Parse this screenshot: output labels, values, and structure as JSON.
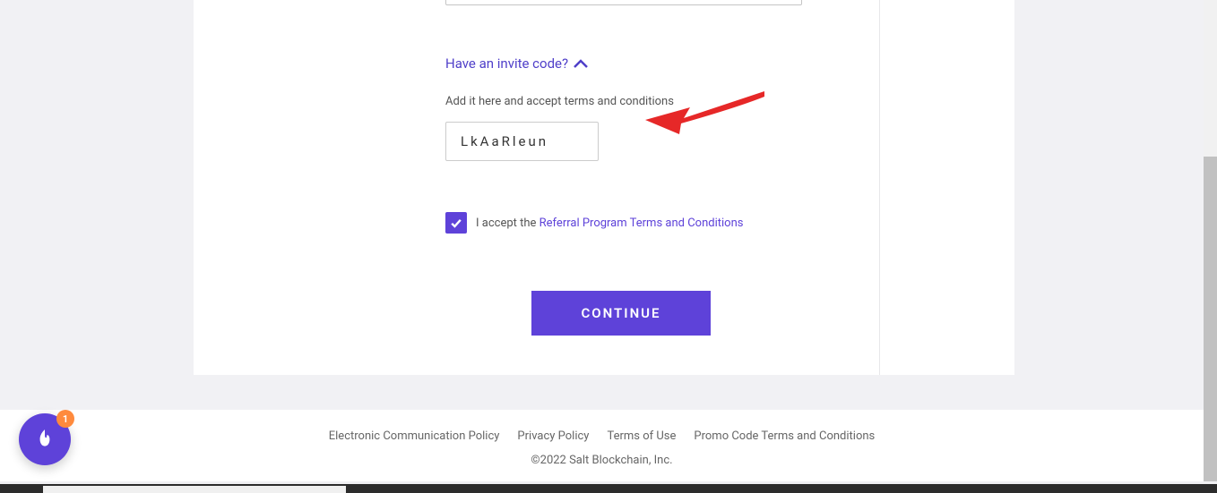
{
  "invite": {
    "toggle_label": "Have an invite code?",
    "helper_text": "Add it here and accept terms and conditions",
    "code_value": "LkAaRleun"
  },
  "terms": {
    "prefix": "I accept the ",
    "link_text": "Referral Program Terms and Conditions"
  },
  "buttons": {
    "continue": "CONTINUE"
  },
  "footer": {
    "links": {
      "ecp": "Electronic Communication Policy",
      "privacy": "Privacy Policy",
      "terms": "Terms of Use",
      "promo": "Promo Code Terms and Conditions"
    },
    "copyright": "©2022 Salt Blockchain, Inc."
  },
  "floating": {
    "count": "1"
  }
}
